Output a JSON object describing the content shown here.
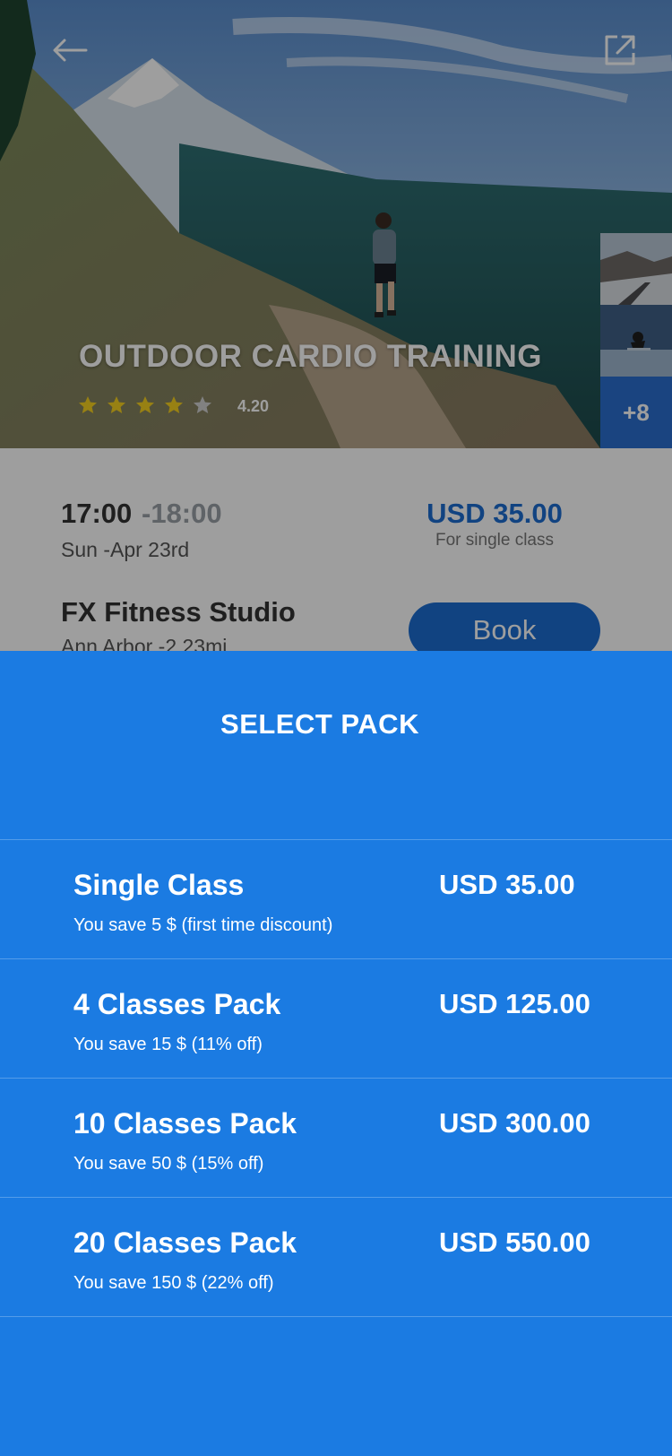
{
  "hero": {
    "title": "OUTDOOR CARDIO TRAINING",
    "rating_value": "4.20",
    "stars_filled": 4,
    "stars_total": 5,
    "back_icon": "arrow-left-icon",
    "share_icon": "external-link-icon",
    "more_photos_label": "+8"
  },
  "details": {
    "time_start": "17:00",
    "time_end": "-18:00",
    "date": "Sun -Apr 23rd",
    "price": "USD 35.00",
    "price_note": "For single class",
    "studio": "FX Fitness Studio",
    "location": "Ann Arbor -2.23mi",
    "book_label": "Book"
  },
  "sheet": {
    "title": "SELECT PACK",
    "packs": [
      {
        "name": "Single Class",
        "price": "USD 35.00",
        "savings": "You save 5 $ (first time discount)"
      },
      {
        "name": "4 Classes Pack",
        "price": "USD 125.00",
        "savings": "You save 15 $ (11% off)"
      },
      {
        "name": "10 Classes Pack",
        "price": "USD 300.00",
        "savings": "You save 50 $ (15% off)"
      },
      {
        "name": "20 Classes Pack",
        "price": "USD 550.00",
        "savings": "You save 150 $ (22% off)"
      }
    ]
  },
  "colors": {
    "sheet_bg": "#1b7be2",
    "accent_blue": "#1c6dd0",
    "star_yellow": "#f5d020"
  }
}
